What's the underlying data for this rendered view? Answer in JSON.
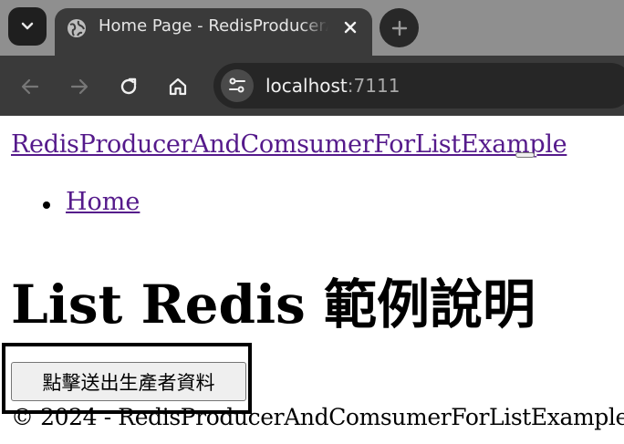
{
  "browser": {
    "tab_title": "Home Page - RedisProducerAndComsumerForListExample",
    "url_host": "localhost",
    "url_port": ":7111",
    "icons": {
      "tab_search": "chevron-down-icon",
      "favicon": "globe-icon",
      "close": "close-icon",
      "new_tab": "plus-icon",
      "back": "arrow-left-icon",
      "forward": "arrow-right-icon",
      "reload": "reload-icon",
      "home": "home-icon",
      "site_info": "tune-icon"
    }
  },
  "page": {
    "brand": "RedisProducerAndComsumerForListExample",
    "nav_items": [
      {
        "label": "Home"
      }
    ],
    "heading": "List Redis 範例說明",
    "send_button": "點擊送出生產者資料",
    "footer": "© 2024 - RedisProducerAndComsumerForListExample"
  },
  "colors": {
    "link": "#551a8b",
    "chrome_dark": "#3a3a3a",
    "tabstrip": "#8f8f8f",
    "highlight_border": "#000000"
  }
}
